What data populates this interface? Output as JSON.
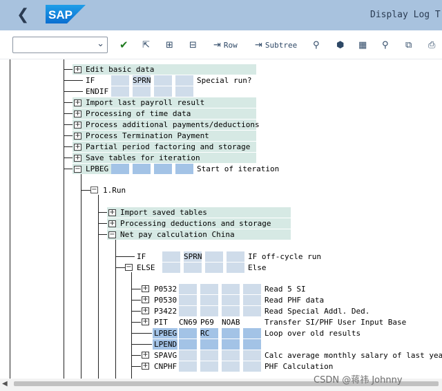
{
  "header": {
    "title": "Display Log Tre",
    "logo_text": "SAP"
  },
  "toolbar": {
    "dropdown_value": "",
    "row_label": "Row",
    "subtree_label": "Subtree"
  },
  "tree": {
    "edit_basic_data": "Edit basic data",
    "if1": {
      "op": "IF",
      "c2": "SPRN",
      "desc": "Special run?"
    },
    "endif": "ENDIF",
    "import_last_payroll": "Import last payroll result",
    "processing_time_data": "Processing of time data",
    "process_additional": "Process additional payments/deductions",
    "process_termination": "Process Termination Payment",
    "partial_period": "Partial period factoring and storage",
    "save_tables": "Save tables for iteration",
    "lpbeg": {
      "op": "LPBEG",
      "desc": "Start of iteration"
    },
    "run1": "1.Run",
    "import_saved": "Import saved tables",
    "processing_deductions": "Processing deductions and storage",
    "net_pay_china": "Net pay calculation China",
    "if2": {
      "op": "IF",
      "c2": "SPRN",
      "desc": "IF off-cycle run"
    },
    "else": {
      "op": "ELSE",
      "desc": "Else"
    },
    "rows": [
      {
        "op": "P0532",
        "c1": "",
        "c2": "",
        "c3": "",
        "desc": "Read 5 SI"
      },
      {
        "op": "P0530",
        "c1": "",
        "c2": "",
        "c3": "",
        "desc": "Read PHF data"
      },
      {
        "op": "P3422",
        "c1": "",
        "c2": "",
        "c3": "",
        "desc": "Read Special Addl. Ded."
      },
      {
        "op": "PIT",
        "c1": "CN69",
        "c2": "P69",
        "c3": "NOAB",
        "desc": "Transfer SI/PHF User Input Base"
      },
      {
        "op": "LPBEG",
        "c1": "",
        "c2": "RC",
        "c3": "",
        "desc": "Loop over old results"
      },
      {
        "op": "LPEND",
        "c1": "",
        "c2": "",
        "c3": "",
        "desc": ""
      },
      {
        "op": "SPAVG",
        "c1": "",
        "c2": "",
        "c3": "",
        "desc": "Calc average monthly salary of last year"
      },
      {
        "op": "CNPHF",
        "c1": "",
        "c2": "",
        "c3": "",
        "desc": "PHF Calculation"
      }
    ]
  },
  "watermark": "CSDN @蒋祎 Johnny"
}
